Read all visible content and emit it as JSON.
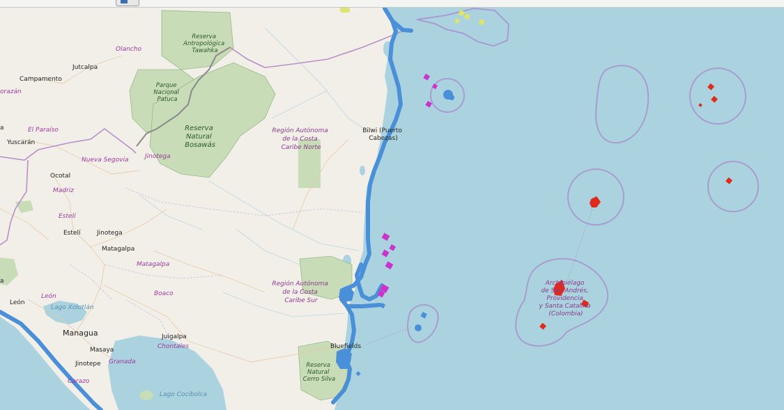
{
  "map": {
    "colors": {
      "sea": "#aad3df",
      "land": "#f2efe9",
      "reserve": "#c8dcb8",
      "border_admin": "#b98fc8",
      "border_national": "#8a8a8a",
      "highlight_blue": "#4a90d9",
      "highlight_magenta": "#cc33cc",
      "highlight_red": "#e02a1c",
      "highlight_yellow": "#dde36c",
      "eez_outline": "#a89cd0"
    },
    "labels": {
      "olancho": "Olancho",
      "juticalpa": "Jutcalpa",
      "campamento": "Campamento",
      "morazan": "orazán",
      "el_paraiso": "El Paraíso",
      "yuscaran": "Yuscarán",
      "nueva_segovia": "Nueva Segovia",
      "jinotega_dept": "Jinotega",
      "ocotal": "Ocotal",
      "madriz": "Madriz",
      "esteli_dept": "Estelí",
      "esteli_city": "Estelí",
      "jinotega_city": "Jinotega",
      "matagalpa_city": "Matagalpa",
      "matagalpa_dept": "Matagalpa",
      "boaco": "Boaco",
      "leon_dept": "León",
      "leon_city": "León",
      "lago_xolotlan": "Lago Xolotlán",
      "managua": "Managua",
      "masaya": "Masaya",
      "jinotepe": "Jinotepe",
      "granada": "Granada",
      "carazo": "Carazo",
      "juigalpa": "Juigalpa",
      "chontales": "Chontales",
      "lago_cocibolca": "Lago Cocibolca",
      "bluefields": "Bluefields",
      "bilwi": [
        "Bilwi (Puerto",
        "Cabezas)"
      ],
      "raccn": [
        "Región Autónoma",
        "de la Costa",
        "Caribe Norte"
      ],
      "raccs": [
        "Región Autónoma",
        "de la Costa",
        "Caribe Sur"
      ],
      "bosawas": [
        "Reserva",
        "Natural",
        "Bosawás"
      ],
      "patuca": [
        "Parque",
        "Nacional",
        "Patuca"
      ],
      "tawahka": [
        "Reserva",
        "Antropológica",
        "Tawahka"
      ],
      "cerro_silva": [
        "Reserva",
        "Natural",
        "Cerro Silva"
      ],
      "san_andres": [
        "Archipiélago",
        "de San Andrés,",
        "Providencia",
        "y Santa Catalina",
        "(Colombia)"
      ],
      "left_cut": "a",
      "left_cut2": "a"
    }
  }
}
